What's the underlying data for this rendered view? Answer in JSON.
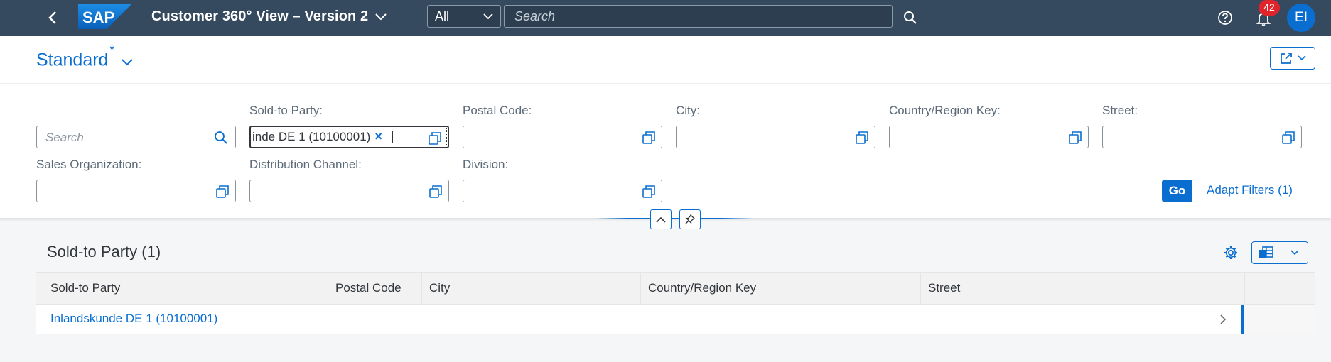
{
  "shell": {
    "title": "Customer 360° View – Version 2",
    "logo_text": "SAP",
    "scope": "All",
    "search_placeholder": "Search",
    "notification_count": "42",
    "user_initials": "EI"
  },
  "header": {
    "variant": "Standard",
    "variant_modified": "*"
  },
  "filters": {
    "search_placeholder": "Search",
    "sold_to_party": {
      "label": "Sold-to Party:",
      "token": "inde DE 1 (10100001)",
      "token_remove": "×"
    },
    "postal_code": {
      "label": "Postal Code:",
      "value": ""
    },
    "city": {
      "label": "City:",
      "value": ""
    },
    "country_region_key": {
      "label": "Country/Region Key:",
      "value": ""
    },
    "street": {
      "label": "Street:",
      "value": ""
    },
    "sales_organization": {
      "label": "Sales Organization:",
      "value": ""
    },
    "distribution_channel": {
      "label": "Distribution Channel:",
      "value": ""
    },
    "division": {
      "label": "Division:",
      "value": ""
    },
    "go_label": "Go",
    "adapt_label": "Adapt Filters (1)"
  },
  "table": {
    "title": "Sold-to Party (1)",
    "columns": [
      "Sold-to Party",
      "Postal Code",
      "City",
      "Country/Region Key",
      "Street"
    ],
    "rows": [
      {
        "sold_to_party": "Inlandskunde DE 1 (10100001)",
        "postal_code": "",
        "city": "",
        "country_region_key": "",
        "street": ""
      }
    ]
  },
  "colors": {
    "shell_bg": "#354a5f",
    "brand": "#0a6ed1",
    "badge": "#e0242b"
  },
  "icons": {
    "back": "chevron-left-icon",
    "title_menu": "chevron-down-icon",
    "search": "magnifier-icon",
    "help": "question-circle-icon",
    "notifications": "bell-icon",
    "value_help": "value-help-icon",
    "share": "share-icon",
    "collapse": "chevron-up-icon",
    "pin": "pin-icon",
    "settings": "gear-icon",
    "export": "spreadsheet-icon",
    "row_nav": "chevron-right-icon"
  }
}
